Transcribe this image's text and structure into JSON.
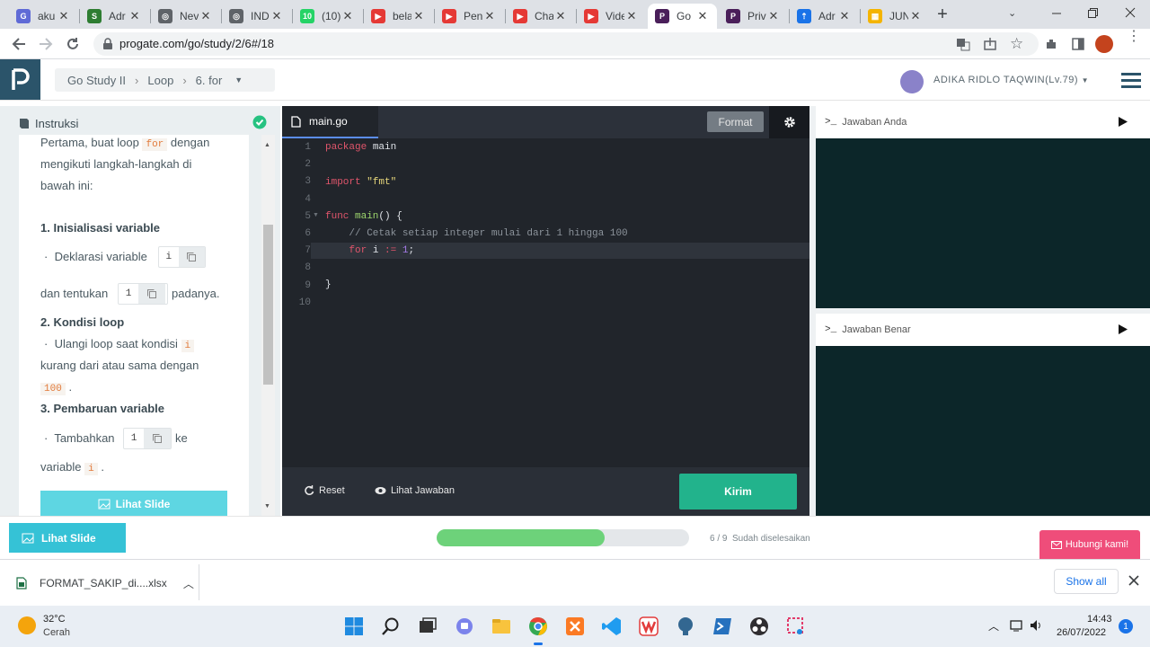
{
  "browser": {
    "tabs": [
      {
        "title": "aku",
        "color": "#5f6ad6",
        "glyph": "G"
      },
      {
        "title": "Adr",
        "color": "#2e7d32",
        "glyph": "S"
      },
      {
        "title": "Nev",
        "color": "#5f6368",
        "glyph": "◎"
      },
      {
        "title": "IND",
        "color": "#5f6368",
        "glyph": "◎"
      },
      {
        "title": "(10)",
        "color": "#25d366",
        "glyph": "10"
      },
      {
        "title": "bela",
        "color": "#e53935",
        "glyph": "▶"
      },
      {
        "title": "Pen",
        "color": "#e53935",
        "glyph": "▶"
      },
      {
        "title": "Cha",
        "color": "#e53935",
        "glyph": "▶"
      },
      {
        "title": "Vide",
        "color": "#e53935",
        "glyph": "▶"
      },
      {
        "title": "Go",
        "color": "#4a1f5a",
        "glyph": "P",
        "active": true
      },
      {
        "title": "Priv",
        "color": "#4a1f5a",
        "glyph": "P"
      },
      {
        "title": "Adr",
        "color": "#1a73e8",
        "glyph": "⇡"
      },
      {
        "title": "JUN",
        "color": "#f4b400",
        "glyph": "▦"
      }
    ],
    "url": "progate.com/go/study/2/6#/18"
  },
  "header": {
    "breadcrumb": [
      "Go Study II",
      "Loop",
      "6. for"
    ],
    "user": "ADIKA RIDLO TAQWIN(Lv.79)"
  },
  "instructions": {
    "title": "Instruksi",
    "intro_1": "Pertama, buat loop",
    "intro_code": "for",
    "intro_2": "dengan",
    "intro_3": "mengikuti langkah-langkah di",
    "intro_4": "bawah ini:",
    "step1_title": "1. Inisialisasi variable",
    "step1_line1": "Deklarasi variable",
    "step1_var": "i",
    "step1_line2": "dan tentukan",
    "step1_val": "1",
    "step1_line3": "padanya.",
    "step2_title": "2. Kondisi loop",
    "step2_line1": "Ulangi loop saat kondisi",
    "step2_var": "i",
    "step2_line2": "kurang dari atau sama dengan",
    "step2_val": "100",
    "step2_dot": ".",
    "step3_title": "3. Pembaruan variable",
    "step3_line1": "Tambahkan",
    "step3_val": "1",
    "step3_line2": "ke",
    "step3_line3": "variable",
    "step3_var": "i",
    "step3_dot": ".",
    "slide_button": "Lihat Slide"
  },
  "editor": {
    "filename": "main.go",
    "format_button": "Format",
    "lines": [
      "1",
      "2",
      "3",
      "4",
      "5",
      "6",
      "7",
      "8",
      "9",
      "10"
    ],
    "code": {
      "l1_kw": "package",
      "l1_rest": " main",
      "l3_kw": "import",
      "l3_str": " \"fmt\"",
      "l5_kw": "func",
      "l5_fn": " main",
      "l5_rest": "() {",
      "l6_comment": "    // Cetak setiap integer mulai dari 1 hingga 100",
      "l7_kw": "    for",
      "l7_rest": " i ",
      "l7_op": ":=",
      "l7_num": " 1",
      "l7_end": ";",
      "l9": "}"
    },
    "reset_button": "Reset",
    "answer_button": "Lihat Jawaban",
    "submit_button": "Kirim"
  },
  "output": {
    "your_answer": "Jawaban Anda",
    "correct_answer": "Jawaban Benar"
  },
  "footer": {
    "slide_button": "Lihat Slide",
    "progress_text": "6 / 9  Sudah diselesaikan",
    "progress_fraction": 0.6667,
    "contact_button": "Hubungi kami!"
  },
  "downloads": {
    "file": "FORMAT_SAKIP_di....xlsx",
    "show_all": "Show all"
  },
  "taskbar": {
    "temperature": "32°C",
    "weather": "Cerah",
    "time": "14:43",
    "date": "26/07/2022",
    "notifications": "1"
  }
}
